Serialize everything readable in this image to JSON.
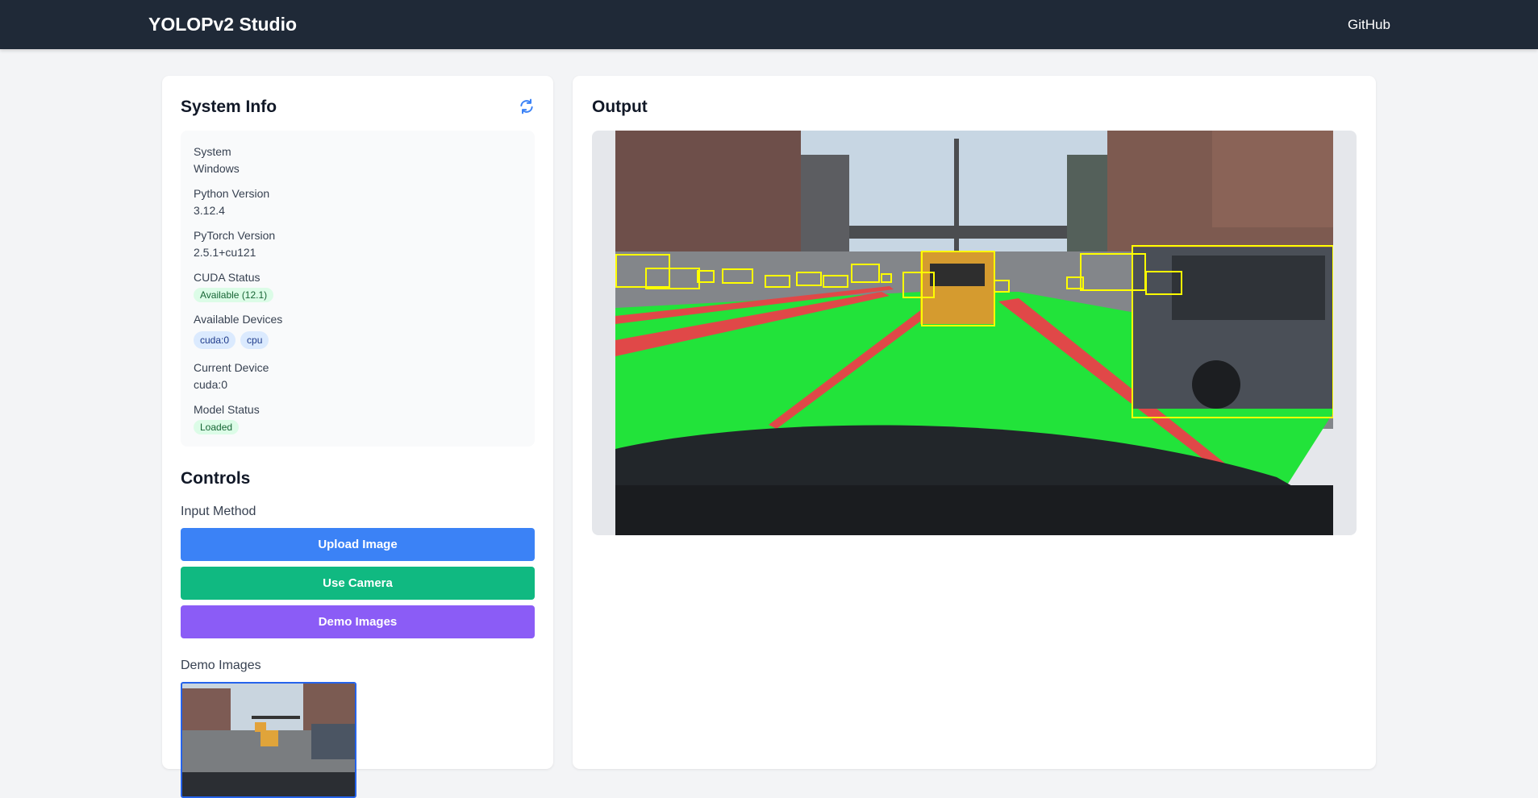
{
  "navbar": {
    "brand": "YOLOPv2 Studio",
    "github_label": "GitHub"
  },
  "system_info": {
    "title": "System Info",
    "refresh_icon": "refresh-icon",
    "items": {
      "system": {
        "label": "System",
        "value": "Windows"
      },
      "python": {
        "label": "Python Version",
        "value": "3.12.4"
      },
      "pytorch": {
        "label": "PyTorch Version",
        "value": "2.5.1+cu121"
      },
      "cuda": {
        "label": "CUDA Status",
        "value": "Available (12.1)"
      },
      "devices": {
        "label": "Available Devices",
        "values": [
          "cuda:0",
          "cpu"
        ]
      },
      "current_device": {
        "label": "Current Device",
        "value": "cuda:0"
      },
      "model": {
        "label": "Model Status",
        "value": "Loaded"
      }
    }
  },
  "controls": {
    "title": "Controls",
    "input_method_label": "Input Method",
    "upload_label": "Upload Image",
    "camera_label": "Use Camera",
    "demo_label": "Demo Images",
    "demo_images_label": "Demo Images"
  },
  "output": {
    "title": "Output"
  },
  "colors": {
    "navbar": "#1f2937",
    "upload": "#3b82f6",
    "camera": "#10b981",
    "demo": "#8b5cf6",
    "drivable_area": "#22e33a",
    "lane_line": "#e04848",
    "detection_box": "#ffff00"
  }
}
